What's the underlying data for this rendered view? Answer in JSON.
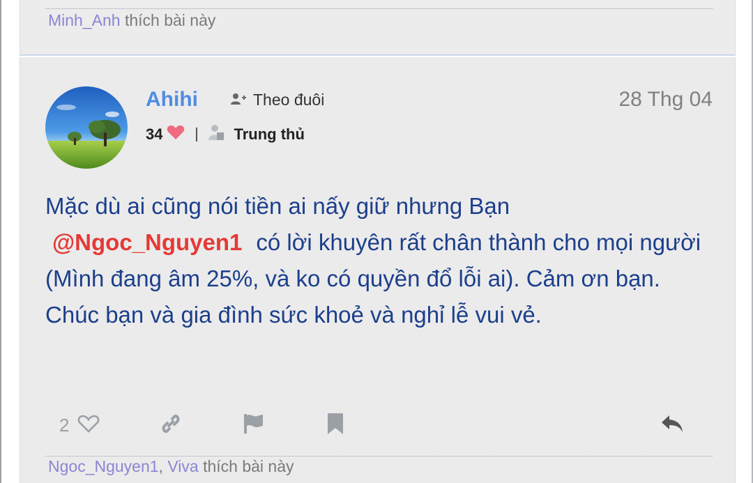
{
  "previous_post": {
    "liked_by": [
      "Minh_Anh"
    ],
    "liked_suffix": "thích bài này"
  },
  "post": {
    "author": "Ahihi",
    "follow_label": "Theo đuôi",
    "date": "28 Thg 04",
    "reputation": "34",
    "rank": "Trung thủ",
    "content": {
      "text_1": "Mặc dù ai cũng nói tiền ai nấy giữ nhưng Bạn",
      "mention": "@Ngoc_Nguyen1",
      "text_2": "có lời khuyên rất chân thành cho mọi người (Mình đang âm 25%, và ko có quyền đổ lỗi ai). Cảm ơn bạn. Chúc bạn và gia đình sức khoẻ và nghỉ lễ vui vẻ."
    },
    "like_count": "2",
    "liked_by": [
      "Ngoc_Nguyen1",
      "Viva"
    ],
    "liked_separator": ",",
    "liked_suffix": "thích bài này"
  },
  "colors": {
    "username": "#4f8de0",
    "content_text": "#1c3f8c",
    "mention": "#e53935",
    "liker_name": "#8a86d4",
    "heart": "#f06a80",
    "icon_gray": "#9aa0a6"
  },
  "icons": {
    "follow": "user-plus-icon",
    "reputation": "heart-icon",
    "rank": "user-rank-icon",
    "like": "heart-outline-icon",
    "link": "link-icon",
    "report": "flag-icon",
    "bookmark": "bookmark-icon",
    "reply": "reply-icon"
  }
}
